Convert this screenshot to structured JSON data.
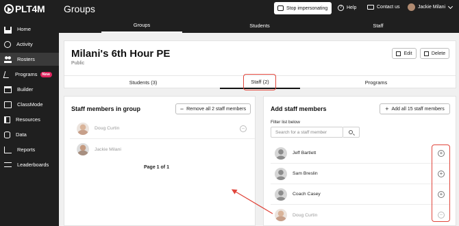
{
  "app": {
    "logo_text": "PLT4M",
    "section_title": "Groups"
  },
  "topbar": {
    "stop_impersonating": "Stop impersonating",
    "help": "Help",
    "contact": "Contact us",
    "user_name": "Jackie Milani"
  },
  "sidebar": {
    "items": [
      {
        "label": "Home",
        "icon": "home-icon"
      },
      {
        "label": "Activity",
        "icon": "activity-icon"
      },
      {
        "label": "Rosters",
        "icon": "users-icon",
        "active": true
      },
      {
        "label": "Programs",
        "icon": "runner-icon",
        "badge": "New"
      },
      {
        "label": "Builder",
        "icon": "builder-icon"
      },
      {
        "label": "ClassMode",
        "icon": "classmode-icon"
      },
      {
        "label": "Resources",
        "icon": "resources-icon"
      },
      {
        "label": "Data",
        "icon": "data-icon"
      },
      {
        "label": "Reports",
        "icon": "reports-icon"
      },
      {
        "label": "Leaderboards",
        "icon": "leaderboards-icon"
      }
    ]
  },
  "subtabs": [
    "Groups",
    "Students",
    "Staff"
  ],
  "group": {
    "title": "Milani's 6th Hour PE",
    "subtitle": "Public",
    "edit": "Edit",
    "delete": "Delete",
    "tabs": [
      "Students (3)",
      "Staff (2)",
      "Programs"
    ]
  },
  "left_panel": {
    "title": "Staff members in group",
    "remove_all": "Remove all 2 staff members",
    "members": [
      "Doug Curtin",
      "Jackie Milani"
    ],
    "pager": "Page 1 of 1"
  },
  "right_panel": {
    "title": "Add staff members",
    "add_all": "Add all 15 staff members",
    "filter_label": "Filter list below",
    "search_placeholder": "Search for a staff member",
    "members": [
      "Jeff Bartlett",
      "Sam Breslin",
      "Coach Casey",
      "Doug Curtin"
    ]
  },
  "colors": {
    "highlight": "#e0453b",
    "sidebar_bg": "#1f1f1f",
    "badge": "#e0245e"
  }
}
